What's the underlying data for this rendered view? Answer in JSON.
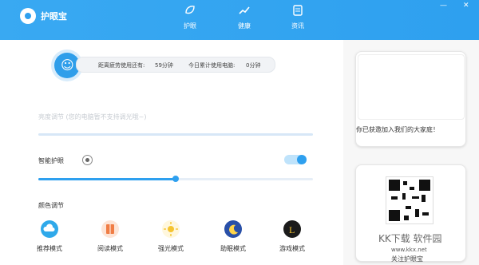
{
  "app": {
    "title": "护眼宝"
  },
  "nav": {
    "tabs": [
      {
        "label": "护眼",
        "icon": "leaf-icon"
      },
      {
        "label": "健康",
        "icon": "trend-icon"
      },
      {
        "label": "资讯",
        "icon": "news-icon"
      }
    ]
  },
  "window": {
    "min_label": "—",
    "close_label": "✕"
  },
  "status": {
    "left_text": "距离疲劳使用还有:",
    "left_value": "59分钟",
    "right_text": "今日累计使用电脑:",
    "right_value": "0分钟",
    "face_icon": "smile-face-icon"
  },
  "brightness": {
    "label": "亮度调节 (您的电脑暂不支持调光哦~)"
  },
  "smart_eye": {
    "label": "智能护眼",
    "enabled": true,
    "level": 0.5
  },
  "color_adjust": {
    "label": "颜色调节",
    "modes": [
      {
        "label": "推荐模式",
        "icon": "cloud-icon",
        "color": "#2fa9ea"
      },
      {
        "label": "阅读模式",
        "icon": "book-icon",
        "color": "#f07d45"
      },
      {
        "label": "强光模式",
        "icon": "sun-icon",
        "color": "#f5c430"
      },
      {
        "label": "助眠模式",
        "icon": "moon-icon",
        "color": "#2950a8"
      },
      {
        "label": "游戏模式",
        "icon": "game-icon",
        "color": "#1b1b1b"
      }
    ]
  },
  "sidebar": {
    "welcome": "你已获邀加入我们的大家庭！"
  },
  "watermark": {
    "brand": "KK下载 软件园",
    "site": "www.kkx.net",
    "subtitle": "关注护眼宝"
  }
}
